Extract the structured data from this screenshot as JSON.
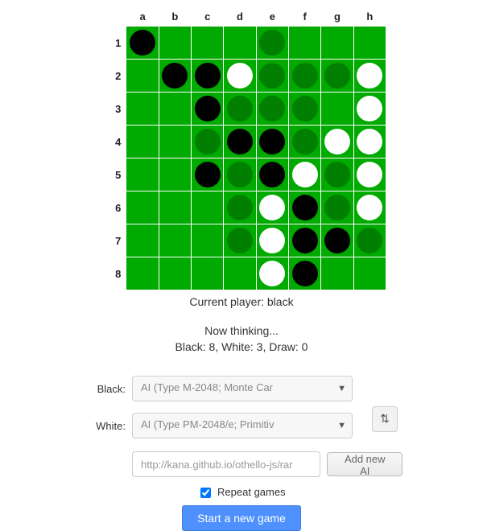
{
  "cols": [
    "a",
    "b",
    "c",
    "d",
    "e",
    "f",
    "g",
    "h"
  ],
  "rows": [
    "1",
    "2",
    "3",
    "4",
    "5",
    "6",
    "7",
    "8"
  ],
  "board": [
    [
      "black",
      "",
      "",
      "",
      "hint",
      "",
      "",
      ""
    ],
    [
      "",
      "black",
      "black",
      "white",
      "hint",
      "hint",
      "hint",
      "white"
    ],
    [
      "",
      "",
      "black",
      "hint",
      "hint",
      "hint",
      "",
      "white"
    ],
    [
      "",
      "",
      "hint",
      "black",
      "black",
      "hint",
      "white",
      "white"
    ],
    [
      "",
      "",
      "black",
      "hint",
      "black",
      "white",
      "hint",
      "white"
    ],
    [
      "",
      "",
      "",
      "hint",
      "white",
      "black",
      "hint",
      "white"
    ],
    [
      "",
      "",
      "",
      "hint",
      "white",
      "black",
      "black",
      "hint"
    ],
    [
      "",
      "",
      "",
      "",
      "white",
      "black",
      "",
      ""
    ]
  ],
  "status": {
    "current_player_label": "Current player: black"
  },
  "thinking": "Now thinking...",
  "score_line": "Black: 8, White: 3, Draw: 0",
  "controls": {
    "black_label": "Black:",
    "white_label": "White:",
    "black_ai": "AI (Type M-2048; Monte Car",
    "white_ai": "AI (Type PM-2048/e; Primitiv",
    "swap_glyph": "⇅",
    "url_value": "http://kana.github.io/othello-js/rar",
    "add_ai_label": "Add new AI",
    "repeat_label": "Repeat games",
    "repeat_checked": true,
    "start_label": "Start a new game"
  }
}
